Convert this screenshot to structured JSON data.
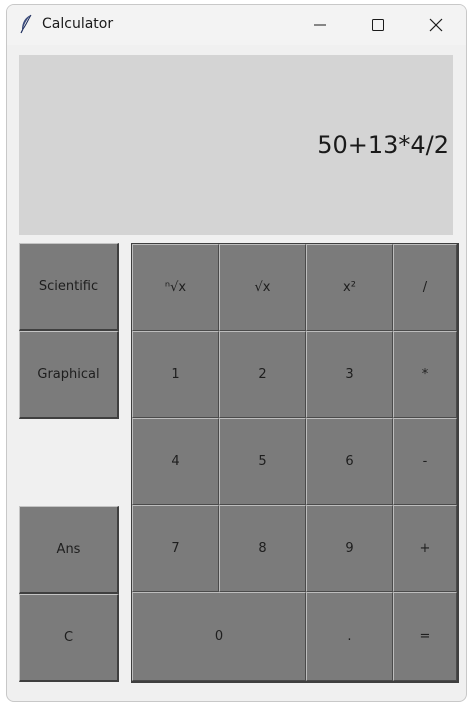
{
  "window": {
    "title": "Calculator"
  },
  "display": {
    "expression": "50+13*4/2"
  },
  "side_buttons": {
    "scientific": "Scientific",
    "graphical": "Graphical",
    "ans": "Ans",
    "clear": "C"
  },
  "keypad": {
    "nth_root": "ⁿ√x",
    "sqrt": "√x",
    "square": "x²",
    "divide": "/",
    "one": "1",
    "two": "2",
    "three": "3",
    "multiply": "*",
    "four": "4",
    "five": "5",
    "six": "6",
    "minus": "-",
    "seven": "7",
    "eight": "8",
    "nine": "9",
    "plus": "+",
    "zero": "0",
    "dot": ".",
    "equals": "="
  },
  "icons": [
    "feather-icon",
    "minimize-icon",
    "maximize-icon",
    "close-icon"
  ]
}
